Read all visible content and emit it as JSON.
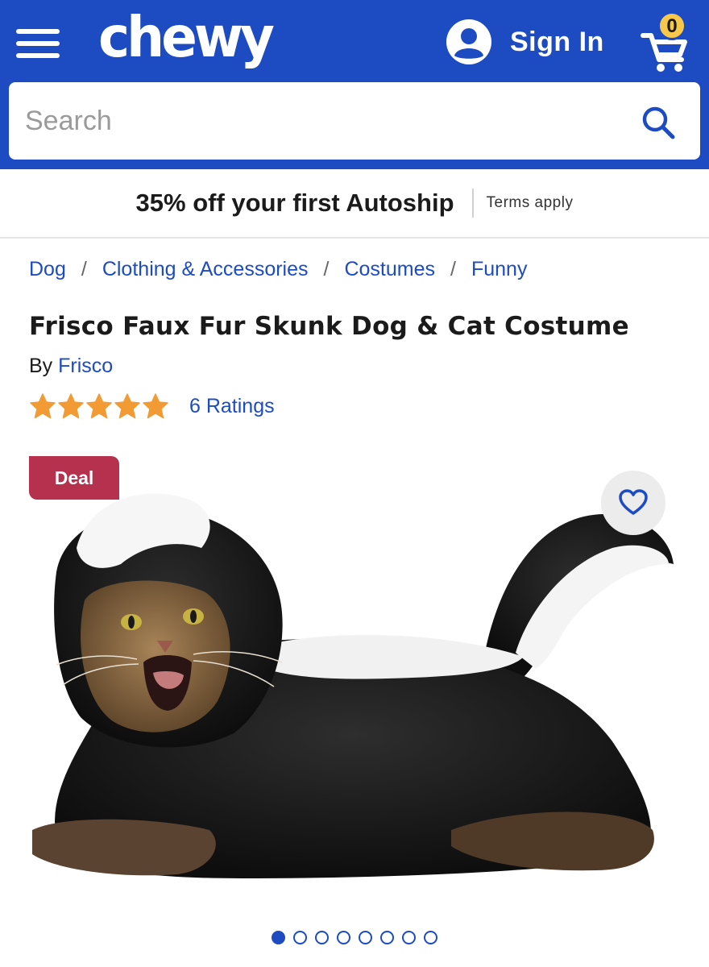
{
  "header": {
    "logo_text": "chewy",
    "signin_label": "Sign In",
    "cart_count": "0",
    "search_placeholder": "Search"
  },
  "promo": {
    "text": "35% off your first Autoship",
    "terms": "Terms apply"
  },
  "breadcrumb": [
    "Dog",
    "Clothing & Accessories",
    "Costumes",
    "Funny"
  ],
  "breadcrumb_separator": "/",
  "product": {
    "title": "Frisco Faux Fur Skunk Dog & Cat Costume",
    "by_label": "By",
    "brand": "Frisco",
    "rating": 5,
    "ratings_text": "6 Ratings",
    "deal_badge": "Deal",
    "image_subject": "cat-in-skunk-costume"
  },
  "carousel": {
    "total": 8,
    "active": 0
  },
  "colors": {
    "brand_blue": "#1d4bc2",
    "deal_red": "#b5314e",
    "star_orange": "#f29b34",
    "cart_badge": "#f8c84a"
  },
  "icons": [
    "menu-icon",
    "user-icon",
    "cart-icon",
    "search-icon",
    "heart-icon",
    "star-icon"
  ]
}
